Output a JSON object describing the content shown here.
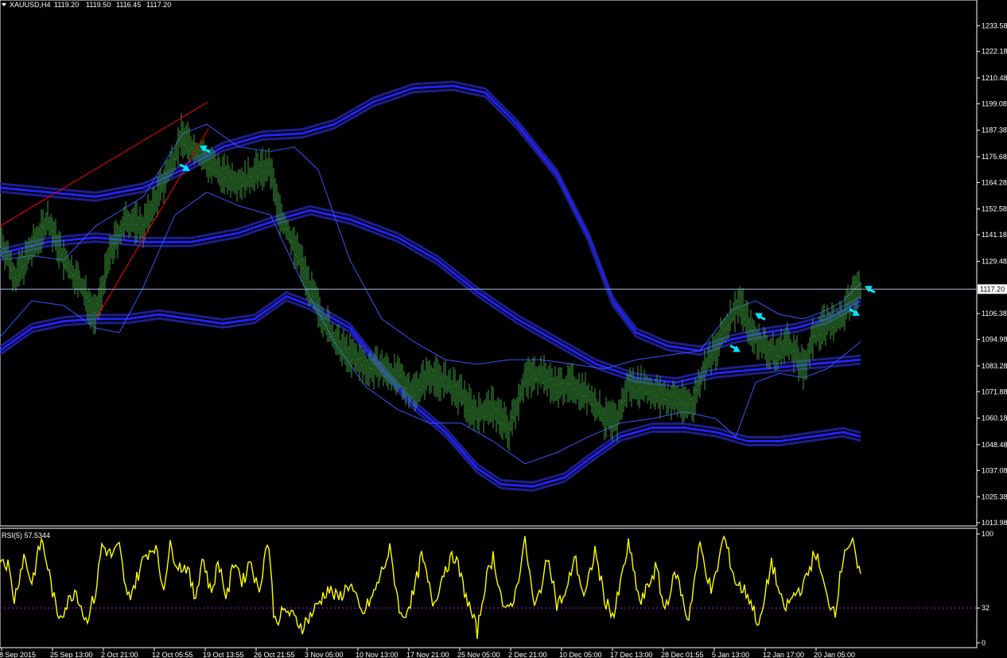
{
  "header": {
    "dropdown_icon": "triangle-down-icon",
    "symbol": "XAUUSD,H4",
    "open": "1119.20",
    "high": "1119.50",
    "low": "1116.45",
    "close": "1117.20"
  },
  "colors": {
    "background": "#000000",
    "axis": "#ffffff",
    "candles": "#3c9a3c",
    "bollinger": "#3355ff",
    "envelope_outer": "#1e1e8c",
    "envelope_inner": "#2222ff",
    "trendline": "#ff0000",
    "arrow": "#00e5ff",
    "rsi_line": "#ffff00",
    "rsi_level": "#a020f0",
    "price_line": "#a0b4d2"
  },
  "chart_data": [
    {
      "type": "candlestick",
      "title": "XAUUSD,H4",
      "current_price": "1117.20",
      "price_ticks": [
        "1233.58",
        "1222.18",
        "1210.48",
        "1199.08",
        "1187.38",
        "1175.68",
        "1164.28",
        "1152.58",
        "1141.18",
        "1129.48",
        "1117.20",
        "1106.38",
        "1094.98",
        "1083.28",
        "1071.88",
        "1060.18",
        "1048.48",
        "1037.08",
        "1025.38",
        "1013.98"
      ],
      "time_ticks": [
        "8 Sep 2015",
        "25 Sep 13:00",
        "2 Oct 21:00",
        "12 Oct 05:55",
        "19 Oct 13:55",
        "26 Oct 21:55",
        "3 Nov 05:00",
        "10 Nov 13:00",
        "17 Nov 21:00",
        "25 Nov 05:00",
        "2 Dec 21:00",
        "10 Dec 05:00",
        "17 Dec 13:00",
        "28 Dec 01:55",
        "5 Jan 13:00",
        "12 Jan 17:00",
        "20 Jan 05:00"
      ],
      "ylim": [
        1013.98,
        1240.0
      ],
      "approx_close_path": [
        [
          0,
          1140
        ],
        [
          20,
          1122
        ],
        [
          40,
          1135
        ],
        [
          60,
          1148
        ],
        [
          80,
          1130
        ],
        [
          100,
          1120
        ],
        [
          120,
          1105
        ],
        [
          140,
          1135
        ],
        [
          160,
          1148
        ],
        [
          180,
          1145
        ],
        [
          200,
          1160
        ],
        [
          215,
          1172
        ],
        [
          228,
          1185
        ],
        [
          240,
          1180
        ],
        [
          255,
          1176
        ],
        [
          270,
          1170
        ],
        [
          290,
          1166
        ],
        [
          310,
          1165
        ],
        [
          325,
          1170
        ],
        [
          340,
          1170
        ],
        [
          350,
          1152
        ],
        [
          365,
          1140
        ],
        [
          380,
          1128
        ],
        [
          395,
          1112
        ],
        [
          410,
          1102
        ],
        [
          425,
          1092
        ],
        [
          440,
          1088
        ],
        [
          460,
          1083
        ],
        [
          480,
          1082
        ],
        [
          500,
          1078
        ],
        [
          520,
          1072
        ],
        [
          540,
          1080
        ],
        [
          560,
          1076
        ],
        [
          580,
          1070
        ],
        [
          600,
          1062
        ],
        [
          620,
          1065
        ],
        [
          640,
          1055
        ],
        [
          660,
          1078
        ],
        [
          680,
          1080
        ],
        [
          700,
          1074
        ],
        [
          720,
          1075
        ],
        [
          740,
          1070
        ],
        [
          760,
          1060
        ],
        [
          775,
          1058
        ],
        [
          790,
          1075
        ],
        [
          810,
          1074
        ],
        [
          830,
          1070
        ],
        [
          850,
          1068
        ],
        [
          870,
          1066
        ],
        [
          885,
          1082
        ],
        [
          900,
          1090
        ],
        [
          915,
          1102
        ],
        [
          930,
          1112
        ],
        [
          945,
          1098
        ],
        [
          960,
          1092
        ],
        [
          975,
          1088
        ],
        [
          990,
          1094
        ],
        [
          1010,
          1082
        ],
        [
          1025,
          1098
        ],
        [
          1040,
          1102
        ],
        [
          1060,
          1104
        ],
        [
          1075,
          1118
        ],
        [
          1082,
          1117
        ]
      ],
      "bollinger_period_bands": {
        "upper": [
          [
            0,
            1130
          ],
          [
            40,
            1132
          ],
          [
            80,
            1130
          ],
          [
            120,
            1145
          ],
          [
            180,
            1158
          ],
          [
            230,
            1186
          ],
          [
            260,
            1190
          ],
          [
            300,
            1180
          ],
          [
            340,
            1178
          ],
          [
            370,
            1180
          ],
          [
            400,
            1170
          ],
          [
            440,
            1130
          ],
          [
            480,
            1104
          ],
          [
            520,
            1094
          ],
          [
            560,
            1086
          ],
          [
            600,
            1084
          ],
          [
            640,
            1086
          ],
          [
            680,
            1086
          ],
          [
            720,
            1084
          ],
          [
            760,
            1082
          ],
          [
            800,
            1086
          ],
          [
            840,
            1088
          ],
          [
            880,
            1090
          ],
          [
            920,
            1108
          ],
          [
            950,
            1112
          ],
          [
            980,
            1106
          ],
          [
            1010,
            1104
          ],
          [
            1040,
            1108
          ],
          [
            1060,
            1112
          ],
          [
            1082,
            1120
          ]
        ],
        "lower": [
          [
            0,
            1096
          ],
          [
            40,
            1112
          ],
          [
            80,
            1110
          ],
          [
            120,
            1100
          ],
          [
            150,
            1098
          ],
          [
            180,
            1118
          ],
          [
            220,
            1150
          ],
          [
            260,
            1160
          ],
          [
            300,
            1154
          ],
          [
            340,
            1150
          ],
          [
            380,
            1120
          ],
          [
            420,
            1094
          ],
          [
            460,
            1074
          ],
          [
            500,
            1064
          ],
          [
            540,
            1058
          ],
          [
            580,
            1058
          ],
          [
            620,
            1050
          ],
          [
            660,
            1040
          ],
          [
            700,
            1045
          ],
          [
            740,
            1052
          ],
          [
            780,
            1058
          ],
          [
            820,
            1060
          ],
          [
            860,
            1063
          ],
          [
            900,
            1060
          ],
          [
            925,
            1052
          ],
          [
            950,
            1076
          ],
          [
            980,
            1080
          ],
          [
            1010,
            1078
          ],
          [
            1040,
            1082
          ],
          [
            1082,
            1094
          ]
        ]
      },
      "envelope_upper": [
        [
          0,
          1162
        ],
        [
          60,
          1160
        ],
        [
          120,
          1158
        ],
        [
          180,
          1162
        ],
        [
          230,
          1170
        ],
        [
          280,
          1180
        ],
        [
          330,
          1185
        ],
        [
          380,
          1186
        ],
        [
          420,
          1190
        ],
        [
          470,
          1200
        ],
        [
          520,
          1206
        ],
        [
          570,
          1207
        ],
        [
          610,
          1204
        ],
        [
          650,
          1190
        ],
        [
          700,
          1168
        ],
        [
          740,
          1140
        ],
        [
          770,
          1112
        ],
        [
          800,
          1098
        ],
        [
          840,
          1092
        ],
        [
          880,
          1090
        ],
        [
          920,
          1095
        ],
        [
          960,
          1098
        ],
        [
          1000,
          1100
        ],
        [
          1040,
          1104
        ],
        [
          1082,
          1112
        ]
      ],
      "envelope_middle": [
        [
          0,
          1133
        ],
        [
          60,
          1138
        ],
        [
          120,
          1140
        ],
        [
          180,
          1138
        ],
        [
          240,
          1138
        ],
        [
          300,
          1142
        ],
        [
          350,
          1148
        ],
        [
          390,
          1152
        ],
        [
          440,
          1148
        ],
        [
          500,
          1140
        ],
        [
          550,
          1130
        ],
        [
          600,
          1116
        ],
        [
          650,
          1104
        ],
        [
          700,
          1094
        ],
        [
          750,
          1084
        ],
        [
          800,
          1078
        ],
        [
          850,
          1076
        ],
        [
          900,
          1080
        ],
        [
          960,
          1082
        ],
        [
          1020,
          1084
        ],
        [
          1082,
          1086
        ]
      ],
      "envelope_lower": [
        [
          0,
          1090
        ],
        [
          40,
          1100
        ],
        [
          80,
          1103
        ],
        [
          120,
          1104
        ],
        [
          160,
          1104
        ],
        [
          200,
          1106
        ],
        [
          240,
          1104
        ],
        [
          280,
          1102
        ],
        [
          320,
          1104
        ],
        [
          360,
          1114
        ],
        [
          390,
          1110
        ],
        [
          440,
          1100
        ],
        [
          480,
          1082
        ],
        [
          520,
          1066
        ],
        [
          560,
          1054
        ],
        [
          600,
          1038
        ],
        [
          630,
          1031
        ],
        [
          670,
          1030
        ],
        [
          710,
          1034
        ],
        [
          740,
          1042
        ],
        [
          780,
          1052
        ],
        [
          820,
          1056
        ],
        [
          860,
          1056
        ],
        [
          900,
          1054
        ],
        [
          940,
          1050
        ],
        [
          980,
          1050
        ],
        [
          1020,
          1052
        ],
        [
          1060,
          1054
        ],
        [
          1082,
          1052
        ]
      ],
      "trendlines": [
        [
          [
            0,
            1145
          ],
          [
            262,
            1200
          ]
        ],
        [
          [
            122,
            1105
          ],
          [
            262,
            1188
          ]
        ]
      ],
      "arrows": [
        {
          "at": [
            230,
            1168
          ],
          "dir": "up"
        },
        {
          "at": [
            260,
            1182
          ],
          "dir": "down"
        },
        {
          "at": [
            922,
            1088
          ],
          "dir": "up"
        },
        {
          "at": [
            958,
            1108
          ],
          "dir": "down"
        },
        {
          "at": [
            1072,
            1104
          ],
          "dir": "up"
        },
        {
          "at": [
            1096,
            1120
          ],
          "dir": "down"
        }
      ]
    },
    {
      "type": "line",
      "title": "RSI(5) 57.5344",
      "label": "RSI(5) 57.5344",
      "y_ticks": [
        "100",
        "32",
        "0"
      ],
      "level": 32,
      "ylim": [
        0,
        100
      ],
      "approx_values": [
        [
          0,
          80
        ],
        [
          10,
          72
        ],
        [
          18,
          40
        ],
        [
          30,
          80
        ],
        [
          40,
          55
        ],
        [
          52,
          95
        ],
        [
          60,
          70
        ],
        [
          72,
          25
        ],
        [
          80,
          30
        ],
        [
          95,
          50
        ],
        [
          108,
          20
        ],
        [
          120,
          45
        ],
        [
          128,
          90
        ],
        [
          140,
          80
        ],
        [
          150,
          88
        ],
        [
          160,
          40
        ],
        [
          170,
          55
        ],
        [
          182,
          80
        ],
        [
          195,
          90
        ],
        [
          205,
          50
        ],
        [
          214,
          88
        ],
        [
          225,
          70
        ],
        [
          235,
          70
        ],
        [
          245,
          40
        ],
        [
          255,
          80
        ],
        [
          265,
          45
        ],
        [
          275,
          75
        ],
        [
          285,
          40
        ],
        [
          295,
          78
        ],
        [
          305,
          55
        ],
        [
          315,
          78
        ],
        [
          325,
          45
        ],
        [
          337,
          98
        ],
        [
          345,
          20
        ],
        [
          360,
          30
        ],
        [
          380,
          15
        ],
        [
          395,
          30
        ],
        [
          412,
          50
        ],
        [
          425,
          40
        ],
        [
          440,
          55
        ],
        [
          455,
          25
        ],
        [
          470,
          45
        ],
        [
          490,
          85
        ],
        [
          505,
          20
        ],
        [
          520,
          45
        ],
        [
          530,
          80
        ],
        [
          545,
          35
        ],
        [
          560,
          70
        ],
        [
          572,
          80
        ],
        [
          585,
          45
        ],
        [
          600,
          10
        ],
        [
          610,
          55
        ],
        [
          620,
          80
        ],
        [
          635,
          25
        ],
        [
          648,
          45
        ],
        [
          660,
          95
        ],
        [
          672,
          30
        ],
        [
          690,
          80
        ],
        [
          700,
          35
        ],
        [
          712,
          45
        ],
        [
          722,
          80
        ],
        [
          735,
          40
        ],
        [
          748,
          85
        ],
        [
          760,
          40
        ],
        [
          772,
          25
        ],
        [
          790,
          90
        ],
        [
          805,
          35
        ],
        [
          825,
          70
        ],
        [
          835,
          30
        ],
        [
          850,
          65
        ],
        [
          865,
          20
        ],
        [
          880,
          90
        ],
        [
          895,
          45
        ],
        [
          910,
          98
        ],
        [
          925,
          55
        ],
        [
          940,
          45
        ],
        [
          955,
          15
        ],
        [
          970,
          75
        ],
        [
          985,
          30
        ],
        [
          1000,
          45
        ],
        [
          1012,
          55
        ],
        [
          1025,
          85
        ],
        [
          1040,
          40
        ],
        [
          1050,
          30
        ],
        [
          1062,
          88
        ],
        [
          1072,
          90
        ],
        [
          1082,
          57
        ]
      ]
    }
  ]
}
